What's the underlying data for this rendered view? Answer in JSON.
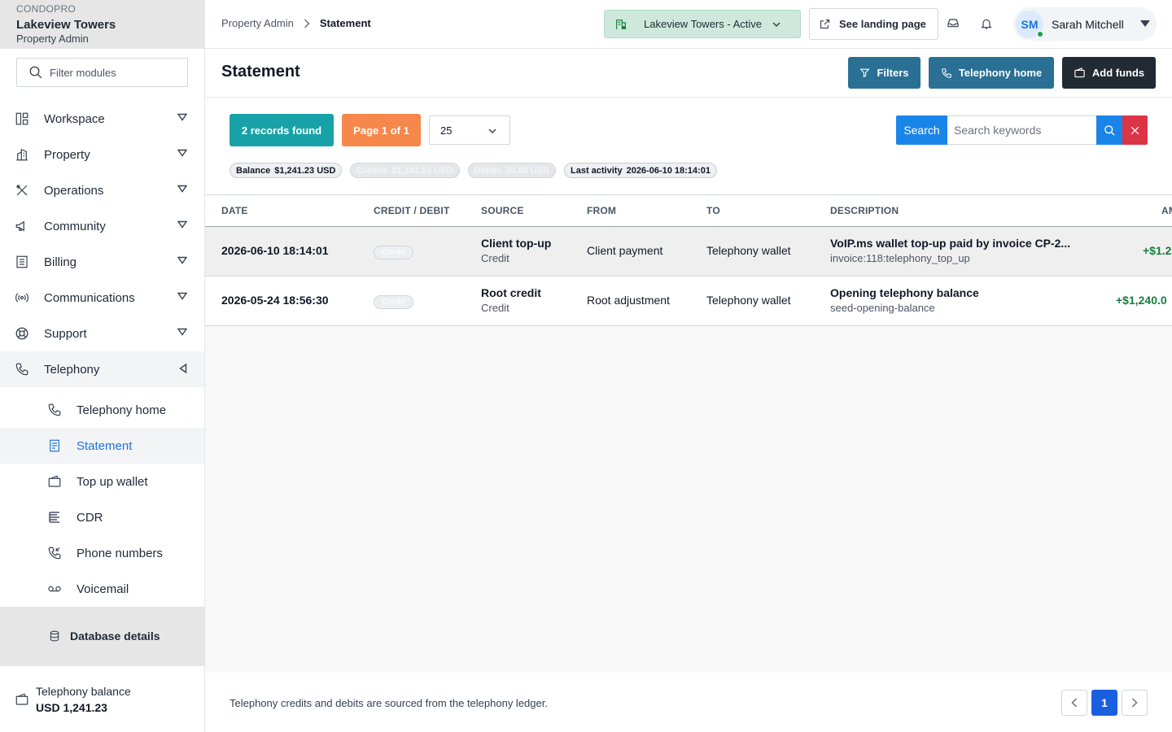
{
  "brand": {
    "app": "CONDOPRO",
    "property": "Lakeview Towers",
    "role": "Property Admin"
  },
  "sidebar": {
    "filter_placeholder": "Filter modules",
    "items": [
      {
        "label": "Workspace",
        "icon": "workspace-icon"
      },
      {
        "label": "Property",
        "icon": "building-icon"
      },
      {
        "label": "Operations",
        "icon": "tools-icon"
      },
      {
        "label": "Community",
        "icon": "megaphone-icon"
      },
      {
        "label": "Billing",
        "icon": "receipt-icon"
      },
      {
        "label": "Communications",
        "icon": "broadcast-icon"
      },
      {
        "label": "Support",
        "icon": "lifebuoy-icon"
      },
      {
        "label": "Telephony",
        "icon": "phone-icon"
      }
    ],
    "telephony_sub": [
      {
        "label": "Telephony home",
        "icon": "phone-icon"
      },
      {
        "label": "Statement",
        "icon": "document-icon"
      },
      {
        "label": "Top up wallet",
        "icon": "wallet-icon"
      },
      {
        "label": "CDR",
        "icon": "list-icon"
      },
      {
        "label": "Phone numbers",
        "icon": "phone-incoming-icon"
      },
      {
        "label": "Voicemail",
        "icon": "voicemail-icon"
      }
    ],
    "database_label": "Database details",
    "balance_label": "Telephony balance",
    "balance_value": "USD 1,241.23"
  },
  "topbar": {
    "breadcrumb": [
      "Property Admin",
      "Statement"
    ],
    "property_select": "Lakeview Towers - Active",
    "landing_label": "See landing page",
    "user": {
      "initials": "SM",
      "name": "Sarah Mitchell"
    }
  },
  "header": {
    "title": "Statement",
    "filters_label": "Filters",
    "telephony_home_label": "Telephony home",
    "add_funds_label": "Add funds"
  },
  "controls": {
    "records": "2 records found",
    "page": "Page 1 of 1",
    "per_page": "25",
    "search_label": "Search",
    "search_placeholder": "Search keywords"
  },
  "summary": [
    {
      "label": "Balance",
      "value": "$1,241.23 USD"
    },
    {
      "label": "Credits",
      "value": "$1,241.23 USD"
    },
    {
      "label": "Debits",
      "value": "$0.00 USD"
    },
    {
      "label": "Last activity",
      "value": "2026-06-10 18:14:01"
    }
  ],
  "table": {
    "columns": [
      "DATE",
      "CREDIT / DEBIT",
      "SOURCE",
      "FROM",
      "TO",
      "DESCRIPTION",
      "AM"
    ],
    "rows": [
      {
        "date": "2026-06-10 18:14:01",
        "type": "Credit",
        "source": "Client top-up",
        "source_sub": "Credit",
        "from": "Client payment",
        "to": "Telephony wallet",
        "description": "VoIP.ms wallet top-up paid by invoice CP-2...",
        "description_sub": "invoice:118:telephony_top_up",
        "amount": "+$1.2"
      },
      {
        "date": "2026-05-24 18:56:30",
        "type": "Credit",
        "source": "Root credit",
        "source_sub": "Credit",
        "from": "Root adjustment",
        "to": "Telephony wallet",
        "description": "Opening telephony balance",
        "description_sub": "seed-opening-balance",
        "amount": "+$1,240.0"
      }
    ]
  },
  "footer": {
    "note": "Telephony credits and debits are sourced from the telephony ledger.",
    "current_page": "1"
  },
  "colors": {
    "accent_blue": "#1a85e8",
    "teal": "#17a2a8",
    "orange": "#f5884a",
    "credit_green": "#15803d",
    "dark_button": "#222a33",
    "steel_button": "#2a6f94"
  }
}
